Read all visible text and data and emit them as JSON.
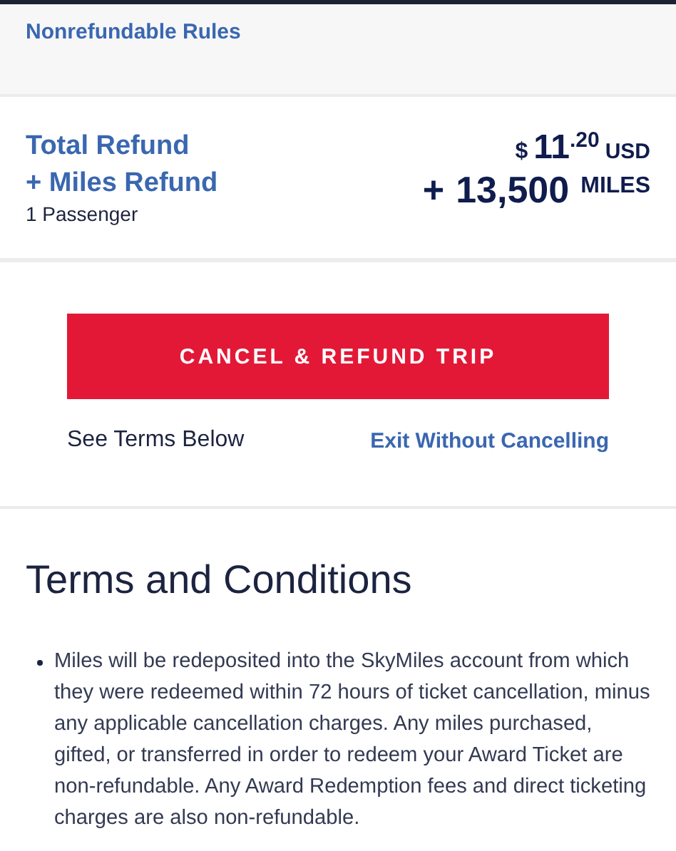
{
  "rules_link": "Nonrefundable Rules",
  "refund": {
    "title_line_1": "Total Refund",
    "title_line_2": "+ Miles Refund",
    "passengers": "1 Passenger",
    "currency_symbol": "$",
    "dollars": "11",
    "cents": ".20",
    "currency": "USD",
    "miles_prefix": "+",
    "miles": "13,500",
    "miles_unit": "MILES"
  },
  "cancel_button": "CANCEL & REFUND TRIP",
  "see_terms": "See Terms Below",
  "exit_link": "Exit Without Cancelling",
  "terms": {
    "title": "Terms and Conditions",
    "items": [
      "Miles will be redeposited into the SkyMiles account from which they were redeemed within 72 hours of ticket cancellation, minus any applicable cancellation charges. Any miles purchased, gifted, or transferred in order to redeem your Award Ticket are non-refundable. Any Award Redemption fees and direct ticketing charges are also non-refundable."
    ]
  }
}
